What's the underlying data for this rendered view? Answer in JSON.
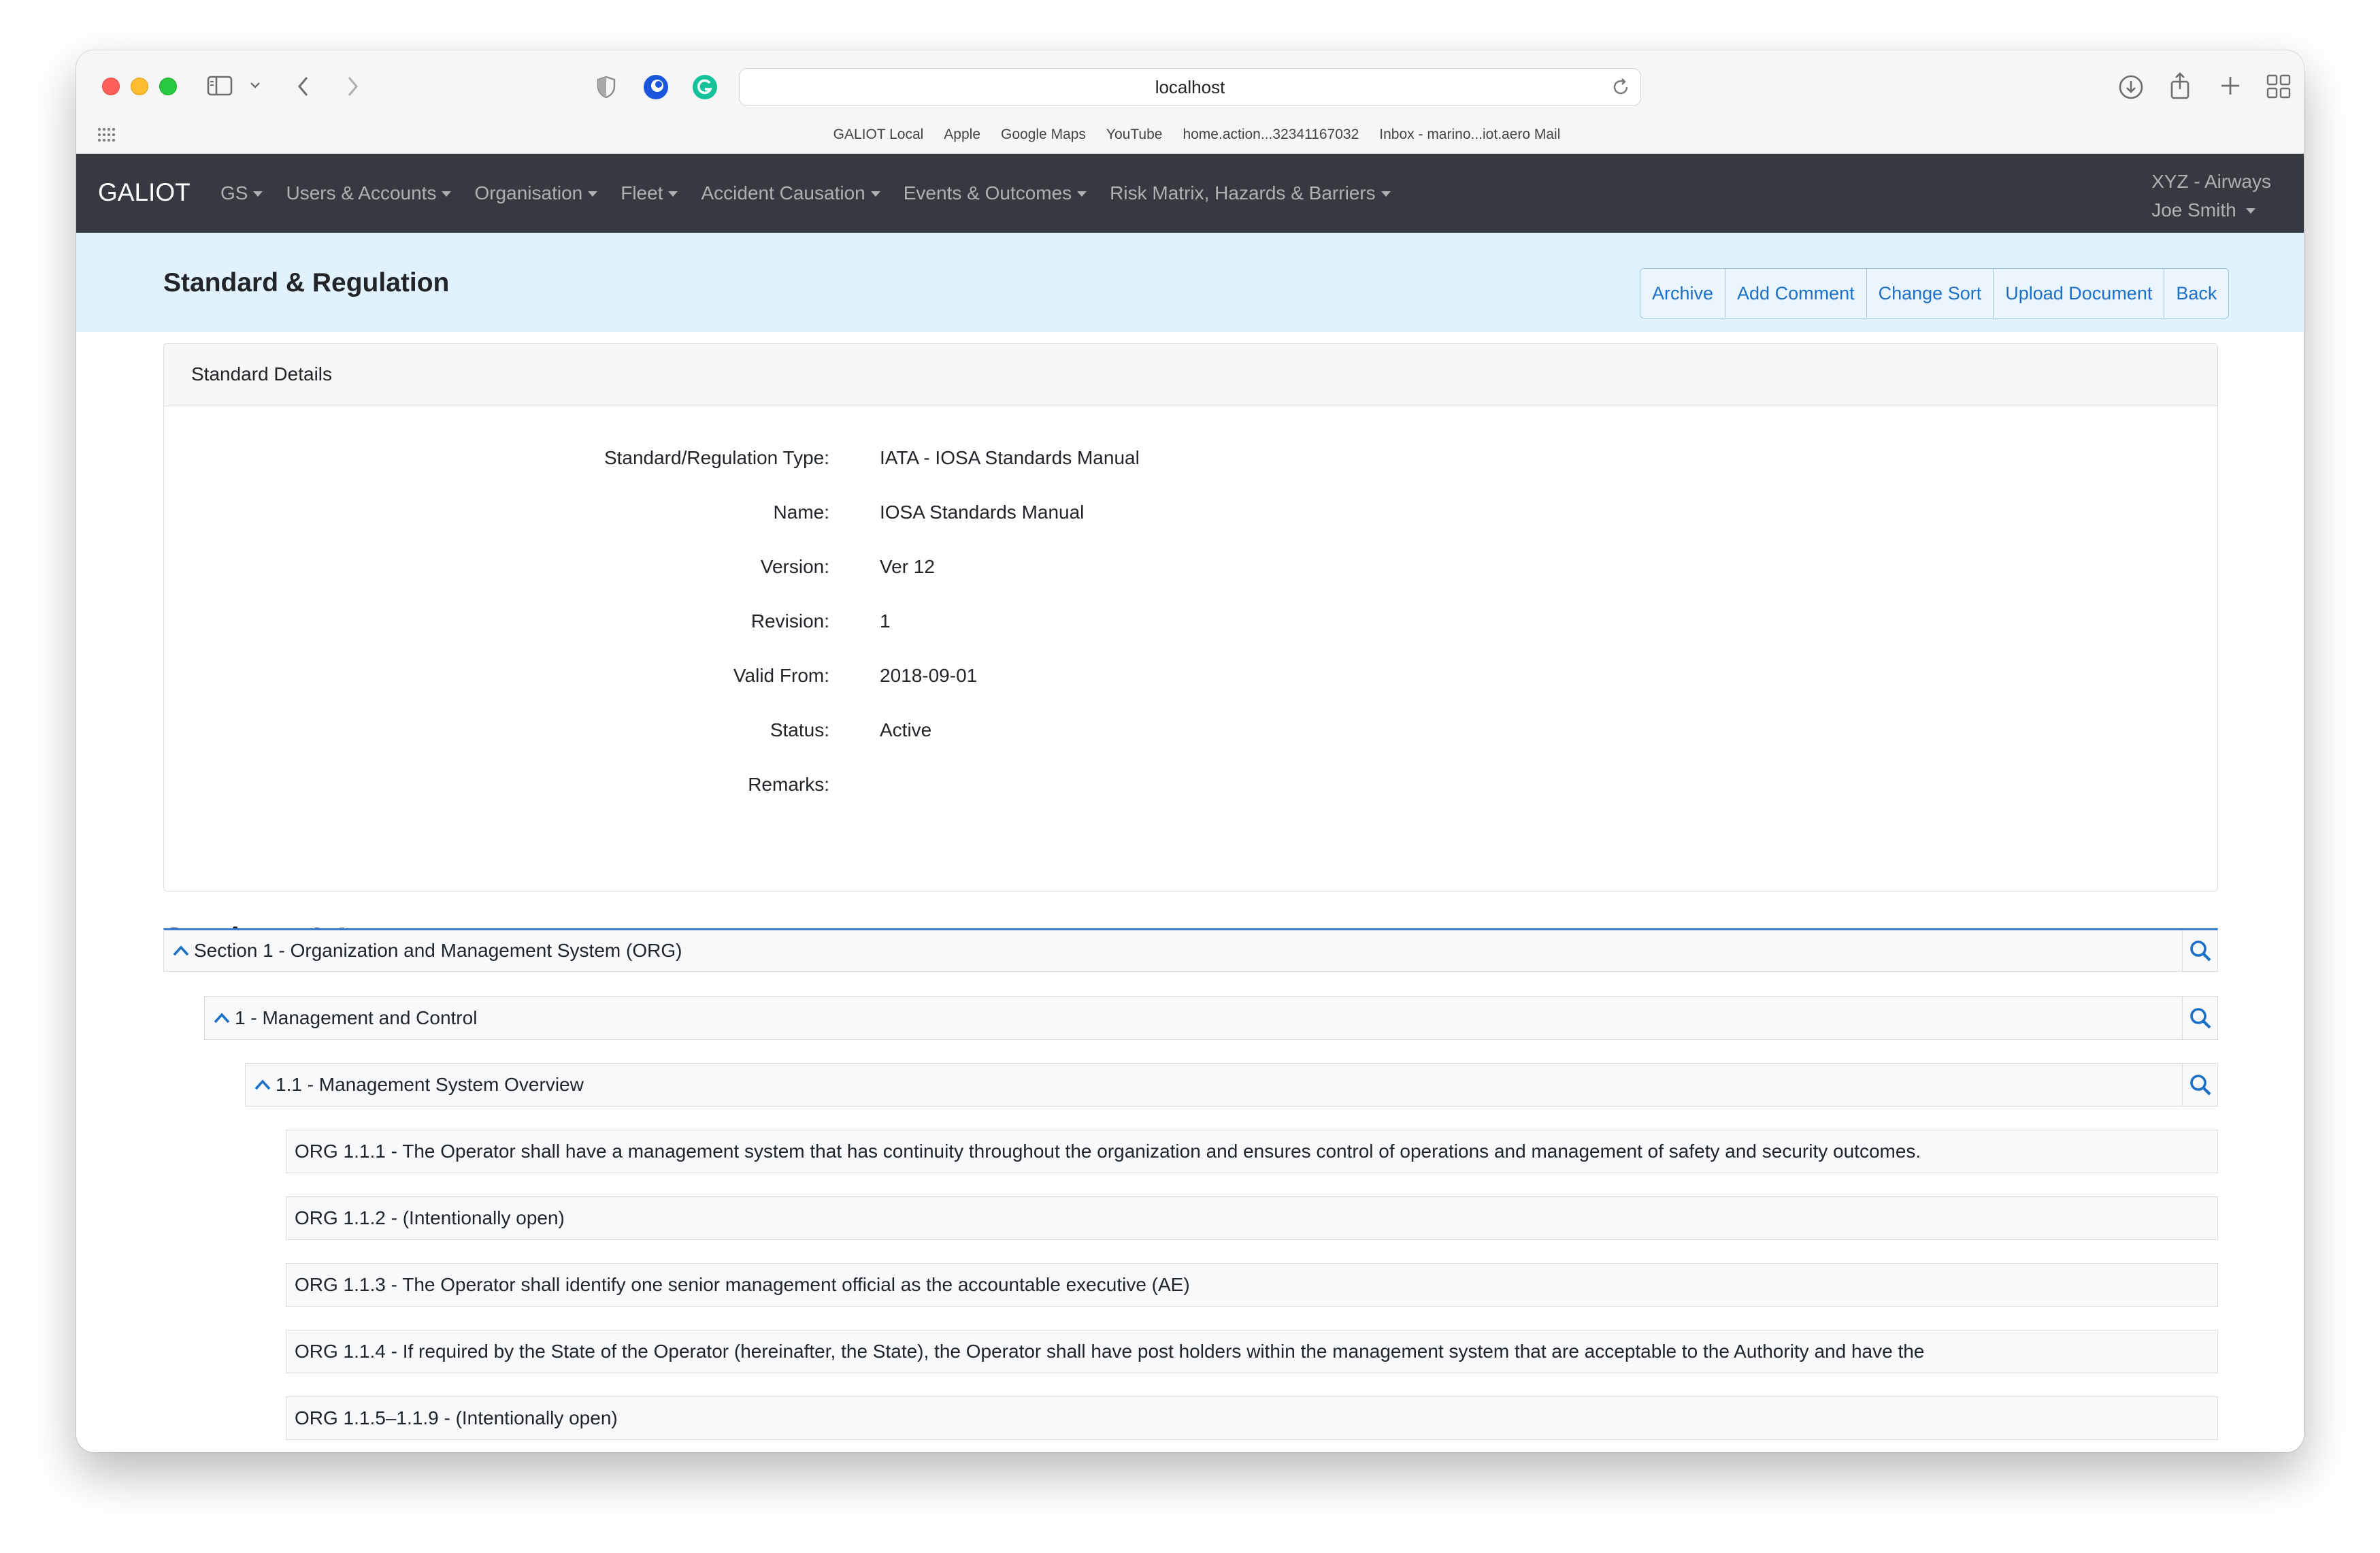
{
  "browser": {
    "url": "localhost",
    "bookmarks": [
      "GALIOT Local",
      "Apple",
      "Google Maps",
      "YouTube",
      "home.action...32341167032",
      "Inbox - marino...iot.aero Mail"
    ]
  },
  "navbar": {
    "brand": "GALIOT",
    "items": [
      "GS",
      "Users & Accounts",
      "Organisation",
      "Fleet",
      "Accident Causation",
      "Events & Outcomes",
      "Risk Matrix, Hazards & Barriers"
    ],
    "org": "XYZ - Airways",
    "user": "Joe Smith"
  },
  "header": {
    "title": "Standard & Regulation",
    "buttons": [
      "Archive",
      "Add Comment",
      "Change Sort",
      "Upload Document",
      "Back"
    ]
  },
  "details": {
    "card_title": "Standard Details",
    "fields": [
      {
        "label": "Standard/Regulation Type:",
        "value": "IATA - IOSA Standards Manual"
      },
      {
        "label": "Name:",
        "value": "IOSA Standards Manual"
      },
      {
        "label": "Version:",
        "value": "Ver 12"
      },
      {
        "label": "Revision:",
        "value": "1"
      },
      {
        "label": "Valid From:",
        "value": "2018-09-01"
      },
      {
        "label": "Status:",
        "value": "Active"
      },
      {
        "label": "Remarks:",
        "value": ""
      }
    ]
  },
  "sections": {
    "title": "Sections & Items",
    "tree": [
      {
        "level": 0,
        "label": "Section 1 - Organization and Management System (ORG)"
      },
      {
        "level": 1,
        "label": "1 - Management and Control"
      },
      {
        "level": 2,
        "label": "1.1 - Management System Overview"
      }
    ],
    "items": [
      "ORG 1.1.1 - The Operator shall have a management system that has continuity throughout the organization and ensures control of operations and management of safety and security outcomes.",
      "ORG 1.1.2 - (Intentionally open)",
      "ORG 1.1.3 - The Operator shall identify one senior management official as the accountable executive (AE)",
      "ORG 1.1.4 - If required by the State of the Operator (hereinafter, the State), the Operator shall have post holders within the management system that are acceptable to the Authority and have the",
      "ORG 1.1.5–1.1.9 - (Intentionally open)"
    ]
  },
  "colors": {
    "navbar": "#343a40",
    "header_bg": "#e2f2fc",
    "link_blue": "#1d70c7",
    "tree_top_border": "#3a7bd5"
  }
}
